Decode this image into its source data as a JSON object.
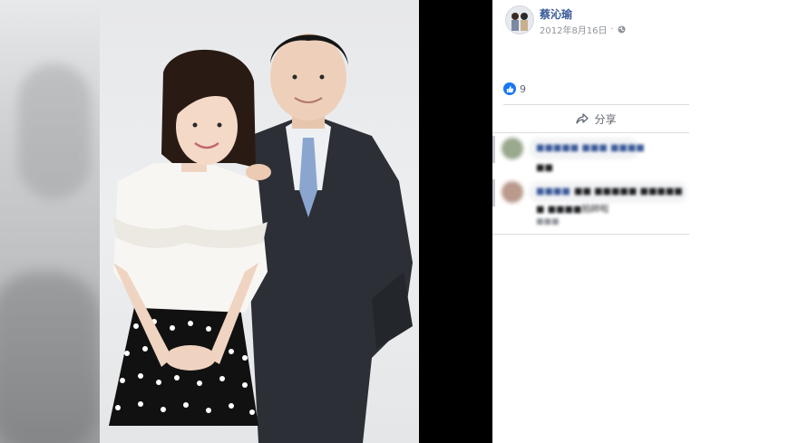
{
  "post": {
    "author": "蔡沁瑜",
    "date": "2012年8月16日",
    "audience_icon": "globe-icon"
  },
  "reactions": {
    "icon": "like-icon",
    "count": "9"
  },
  "actions": {
    "share_label": "分享",
    "share_icon": "share-arrow-icon"
  },
  "comments": [
    {
      "author": "■■■■■ ■■■ ■■■■",
      "text": "■■",
      "meta": ""
    },
    {
      "author": "■■■■",
      "text": "■■ ■■■■■ ■■■■■",
      "text2": "■ ■■■■拍帥啦",
      "meta": "■■■"
    }
  ],
  "colors": {
    "link": "#385898",
    "like_blue": "#1877f2",
    "divider": "#dadde1"
  }
}
